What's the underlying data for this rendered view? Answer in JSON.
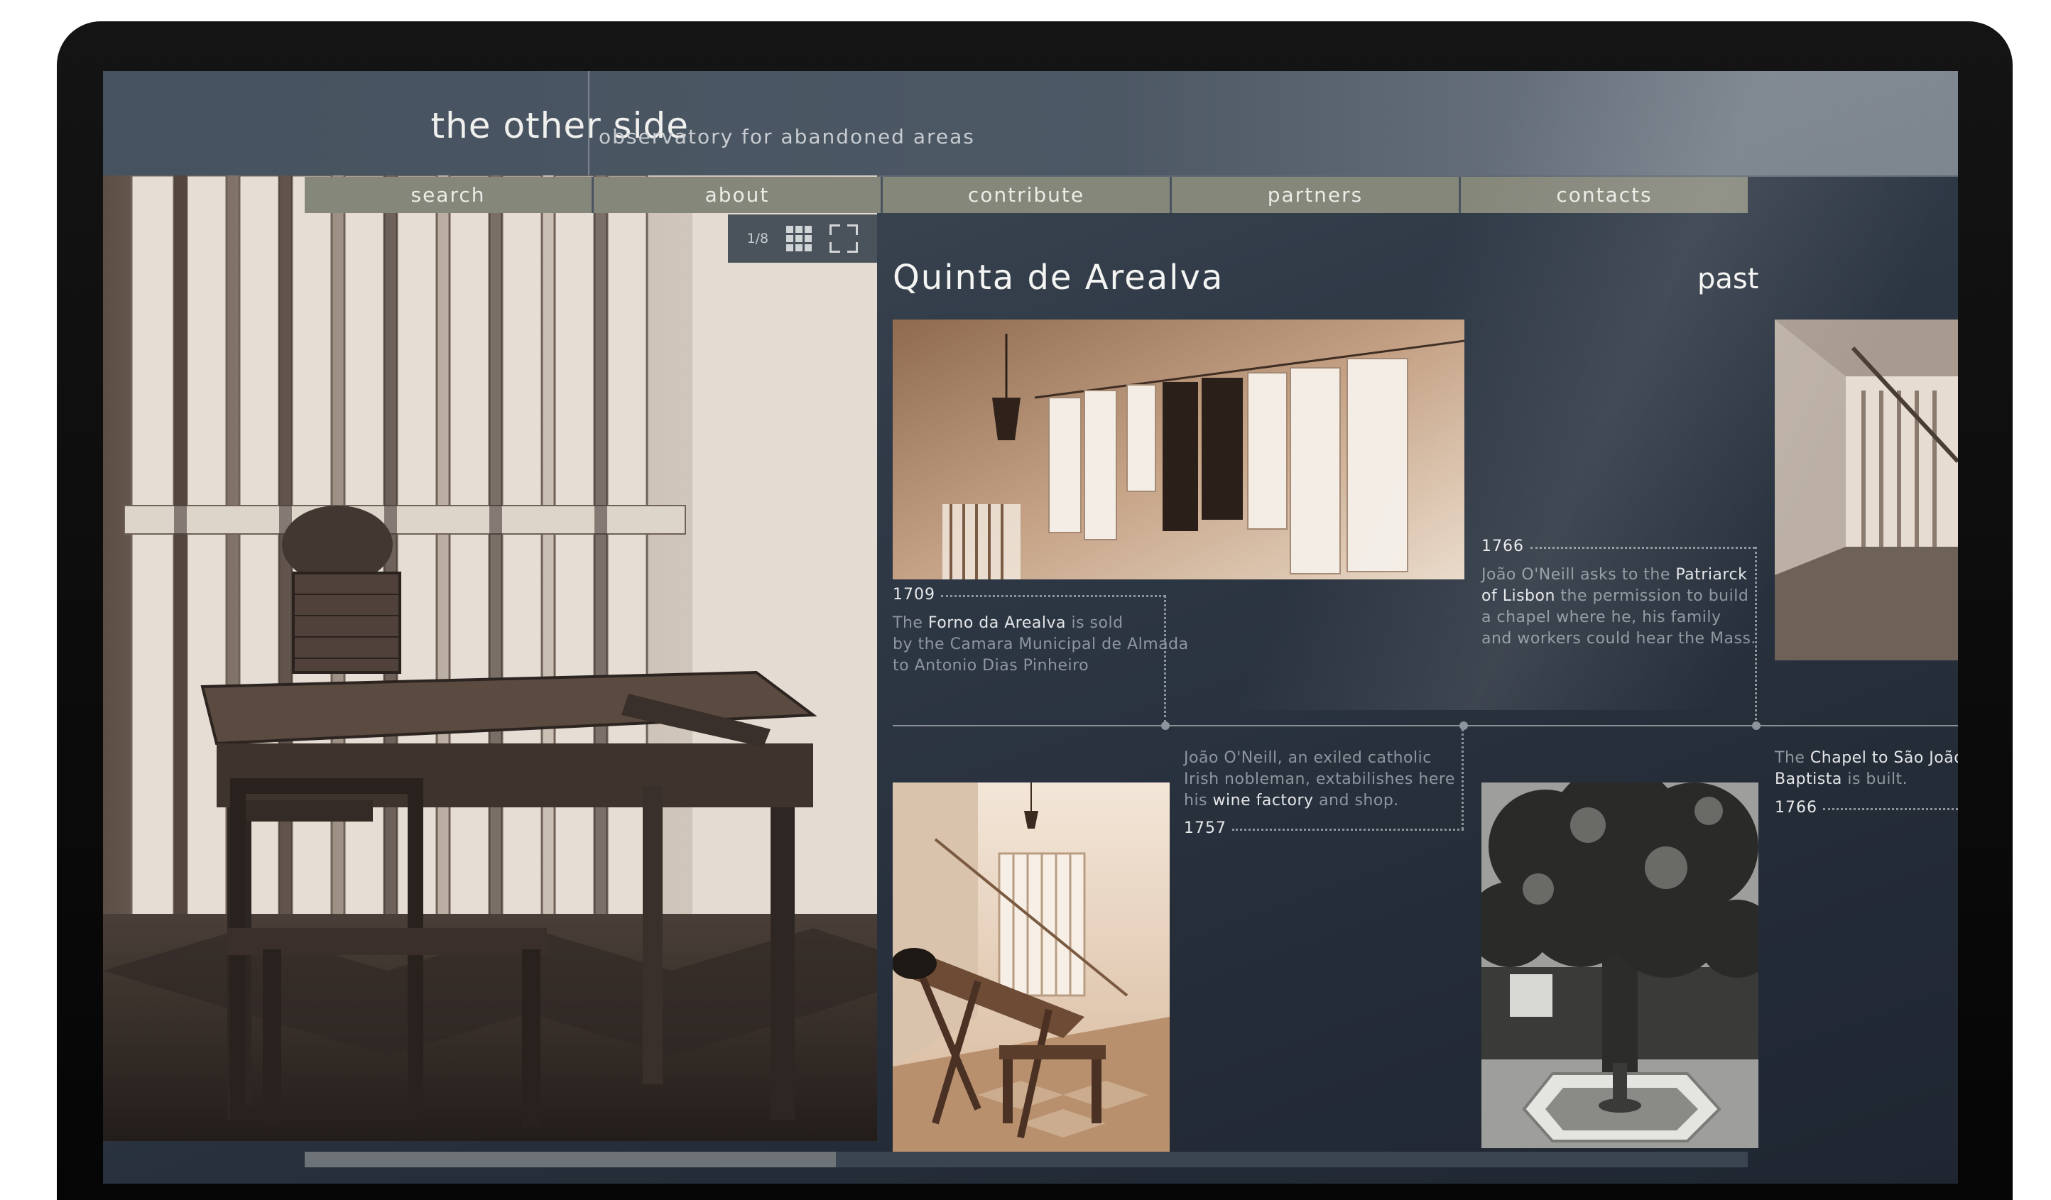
{
  "site": {
    "brand": "the other side",
    "tagline": "observatory for abandoned areas"
  },
  "nav": {
    "items": [
      "search",
      "about",
      "contribute",
      "partners",
      "contacts"
    ]
  },
  "gallery": {
    "counter": "1/8",
    "grid_icon": "grid-view-icon",
    "fullscreen_icon": "fullscreen-icon"
  },
  "place": {
    "title": "Quinta de Arealva",
    "section": "past"
  },
  "timeline": {
    "entries": [
      {
        "year": "1709",
        "lines": [
          [
            "The ",
            "Forno da Arealva",
            " is sold"
          ],
          [
            "by the Camara Municipal de Almada",
            "",
            ""
          ],
          [
            "to Antonio Dias Pinheiro",
            "",
            ""
          ]
        ]
      },
      {
        "year": "1766",
        "lines": [
          [
            "João O'Neill asks to the ",
            "Patriarck",
            ""
          ],
          [
            "",
            "of Lisbon",
            " the permission to build"
          ],
          [
            "a chapel where he, his family",
            "",
            ""
          ],
          [
            "and workers could hear the Mass.",
            "",
            ""
          ]
        ]
      },
      {
        "year": "1757",
        "lines": [
          [
            "João O'Neill, an exiled catholic",
            "",
            ""
          ],
          [
            "Irish nobleman, extabilishes here",
            "",
            ""
          ],
          [
            "his ",
            "wine factory",
            " and shop."
          ]
        ]
      },
      {
        "year": "1766",
        "lines": [
          [
            "The ",
            "Chapel to São João",
            ""
          ],
          [
            "",
            "Baptista",
            " is built."
          ]
        ]
      }
    ]
  },
  "colors": {
    "background": "#2a323e",
    "header": "#4d5865",
    "nav": "#86877b",
    "note_text": "#8e969f",
    "highlight_text": "#e4e6e8"
  }
}
